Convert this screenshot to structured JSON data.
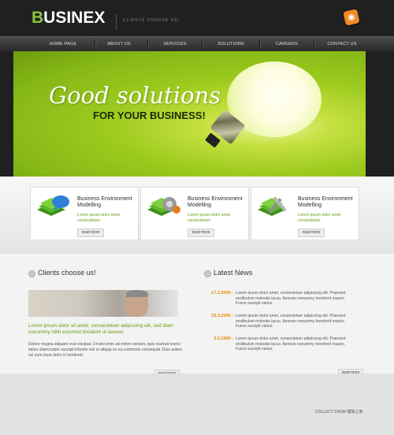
{
  "header": {
    "logo_first": "B",
    "logo_rest": "USINEX",
    "tagline": "CLIENTS CHOOSE US!",
    "rss_icon": "rss-icon"
  },
  "nav": {
    "items": [
      {
        "label": "HOME PAGE"
      },
      {
        "label": "ABOUT US"
      },
      {
        "label": "SERVICES"
      },
      {
        "label": "SOLUTIONS"
      },
      {
        "label": "CAREERS"
      },
      {
        "label": "CONTACT US"
      }
    ]
  },
  "banner": {
    "script": "Good solutions",
    "sub": "FOR YOUR BUSINESS!"
  },
  "features": [
    {
      "title": "Business Environment Modelling",
      "text": "Lorem ipsum dolor amet, consectetuer.",
      "button": "read more",
      "icon": "folder-chat-icon"
    },
    {
      "title": "Business Environment Modelling",
      "text": "Lorem ipsum dolor amet, consectetuer.",
      "button": "read more",
      "icon": "folder-gear-icon"
    },
    {
      "title": "Business Environment Modelling",
      "text": "Lorem ipsum dolor amet, consectetuer.",
      "button": "read more",
      "icon": "folder-wrench-icon"
    }
  ],
  "clients": {
    "heading": "Clients choose us!",
    "lead": "Lorem ipsum dolor sit amet, consectetuer adipiscing elit, sed diam nonummy nibh euismod tincidunt ut laoreet.",
    "body": "Dolore magna aliquam erat volutpat. Ut wisi enim ad minim veniam, quis nostrud exerci tation ullamcorper suscipit lobortis nisl ut aliquip ex ea commodo consequat. Duis autem vel eum iriure dolor in hendrerit.",
    "button": "read more"
  },
  "news": {
    "heading": "Latest News",
    "items": [
      {
        "date": "17.3.2009 -",
        "text": "Lorem ipsum dolor amet, consectetuer adipiscing elit. Praesent vestibulum molestie lacus. Aenean nonummy hendrerit mauris. Fusce suscipit varius."
      },
      {
        "date": "15.3.2009 -",
        "text": "Lorem ipsum dolor amet, consectetuer adipiscing elit. Praesent vestibulum molestie lacus. Aenean nonummy hendrerit mauris. Fusce suscipit varius."
      },
      {
        "date": "3.3.2009 -",
        "text": "Lorem ipsum dolor amet, consectetuer adipiscing elit. Praesent vestibulum molestie lacus. Aenean nonummy hendrerit mauris. Fusce suscipit varius."
      }
    ],
    "button": "read more"
  },
  "footer": {
    "text": "COLLECT FROM 模板之家"
  }
}
